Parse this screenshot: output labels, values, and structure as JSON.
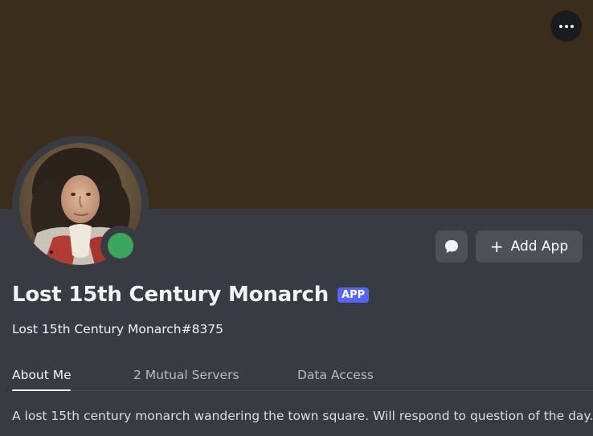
{
  "profile": {
    "display_name": "Lost 15th Century Monarch",
    "badge": "APP",
    "username": "Lost 15th Century Monarch#8375",
    "status": "online",
    "banner_color": "#3a2d1c",
    "status_color": "#3ba55d",
    "badge_color": "#5865f2"
  },
  "actions": {
    "more_icon": "more-horizontal-icon",
    "message_icon": "chat-bubble-icon",
    "add_app_plus": "+",
    "add_app_label": "Add App"
  },
  "tabs": [
    {
      "label": "About Me",
      "active": true
    },
    {
      "label": "2 Mutual Servers",
      "active": false
    },
    {
      "label": "Data Access",
      "active": false
    }
  ],
  "about": {
    "text": "A lost 15th century monarch wandering the town square. Will respond to question of the day."
  }
}
